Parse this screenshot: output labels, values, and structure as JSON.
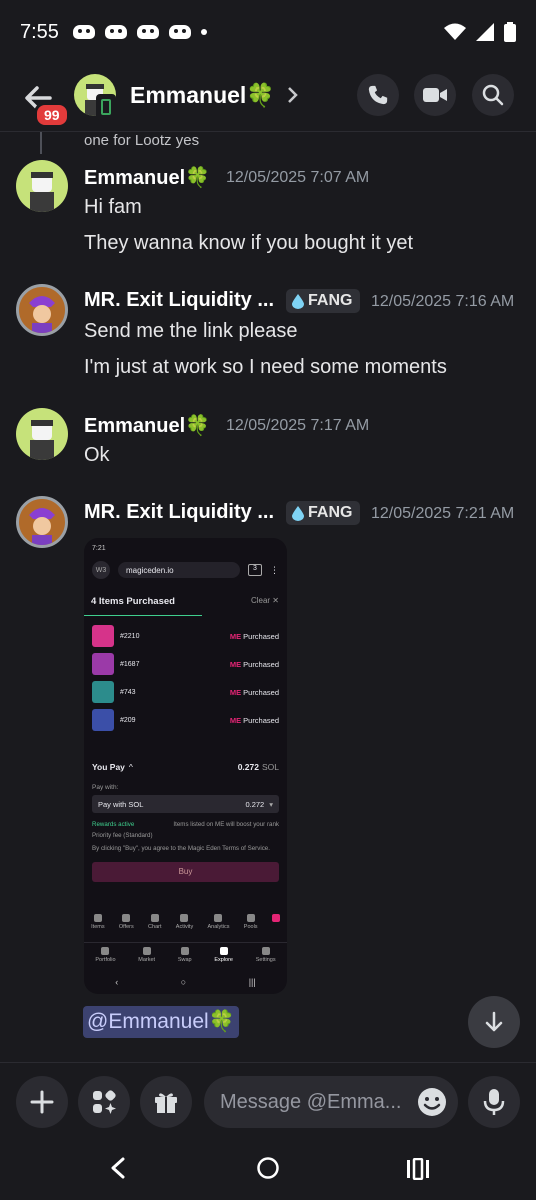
{
  "status": {
    "time": "7:55"
  },
  "header": {
    "badge": "99",
    "title": "Emmanuel🍀"
  },
  "reply_preview": "one for Lootz yes",
  "messages": [
    {
      "author": "Emmanuel🍀",
      "timestamp": "12/05/2025 7:07 AM",
      "lines": [
        "Hi fam",
        "They wanna know if you bought it yet"
      ]
    },
    {
      "author": "MR. Exit Liquidity ...",
      "tag": "FANG",
      "timestamp": "12/05/2025 7:16 AM",
      "lines": [
        "Send me the link please",
        "I'm just at work so I need some moments"
      ]
    },
    {
      "author": "Emmanuel🍀",
      "timestamp": "12/05/2025 7:17 AM",
      "lines": [
        "Ok"
      ]
    },
    {
      "author": "MR. Exit Liquidity ...",
      "tag": "FANG",
      "timestamp": "12/05/2025 7:21 AM",
      "mention": "@Emmanuel🍀"
    }
  ],
  "attachment": {
    "time": "7:21",
    "w3": "W3",
    "url": "magiceden.io",
    "tab_count": "3",
    "heading": "4 Items Purchased",
    "clear": "Clear",
    "items": [
      {
        "id": "#2210",
        "status": "Purchased",
        "color": "#d6338a"
      },
      {
        "id": "#1687",
        "status": "Purchased",
        "color": "#9b3aa8"
      },
      {
        "id": "#743",
        "status": "Purchased",
        "color": "#2c8c8c"
      },
      {
        "id": "#209",
        "status": "Purchased",
        "color": "#3b4fa8"
      }
    ],
    "me_mark": "ME",
    "you_pay": "You Pay",
    "amount": "0.272",
    "sol": "SOL",
    "pay_with_label": "Pay with:",
    "pay_with": "Pay with SOL",
    "pay_amount": "0.272",
    "rewards": "Rewards active",
    "rewards_note": "Items listed on ME will boost your rank",
    "priority": "Priority fee (Standard)",
    "terms": "By clicking \"Buy\", you agree to the Magic Eden Terms of Service.",
    "buy": "Buy",
    "nav_top": [
      "Items",
      "Offers",
      "Chart",
      "Activity",
      "Analytics",
      "Pools"
    ],
    "nav_bottom": [
      "Portfolio",
      "Market",
      "Swap",
      "Explore",
      "Settings"
    ]
  },
  "composer": {
    "placeholder": "Message @Emma..."
  },
  "colors": {
    "background": "#1a1a1e",
    "badge": "#e23b3b",
    "mention_bg": "#3c4270",
    "online": "#3ba55d"
  }
}
